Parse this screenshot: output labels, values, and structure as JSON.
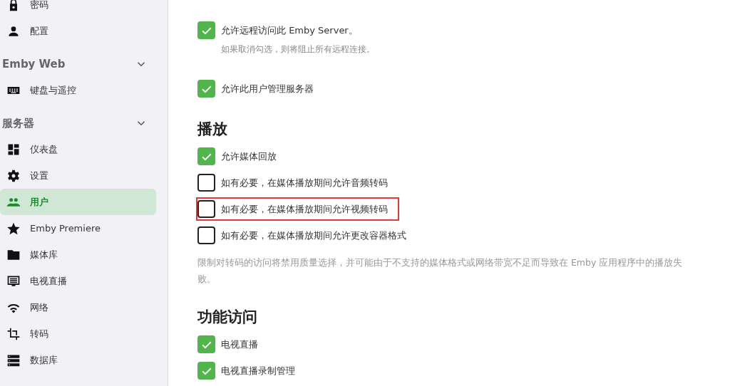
{
  "sidebar": {
    "groups": [
      {
        "items": [
          {
            "label": "密码",
            "kind": "lock",
            "selected": false
          },
          {
            "label": "配置",
            "kind": "person",
            "selected": false
          }
        ]
      },
      {
        "title": "Emby Web",
        "expanded": true,
        "items": [
          {
            "label": "键盘与遥控",
            "kind": "keyboard",
            "selected": false
          }
        ]
      },
      {
        "title": "服务器",
        "expanded": true,
        "items": [
          {
            "label": "仪表盘",
            "kind": "dashboard",
            "selected": false
          },
          {
            "label": "设置",
            "kind": "gear",
            "selected": false
          },
          {
            "label": "用户",
            "kind": "people",
            "selected": true
          },
          {
            "label": "Emby Premiere",
            "kind": "star",
            "selected": false
          },
          {
            "label": "媒体库",
            "kind": "folder",
            "selected": false
          },
          {
            "label": "电视直播",
            "kind": "tv",
            "selected": false
          },
          {
            "label": "网络",
            "kind": "wifi",
            "selected": false
          },
          {
            "label": "转码",
            "kind": "crop",
            "selected": false
          },
          {
            "label": "数据库",
            "kind": "storage",
            "selected": false
          }
        ]
      }
    ]
  },
  "sections": [
    {
      "options": [
        {
          "label": "允许远程访问此 Emby Server。",
          "checked": true,
          "highlighted": false,
          "hint": "如果取消勾选，则将阻止所有远程连接。"
        },
        {
          "label": "允许此用户管理服务器",
          "checked": true,
          "highlighted": false
        }
      ]
    },
    {
      "title": "播放",
      "options": [
        {
          "label": "允许媒体回放",
          "checked": true,
          "highlighted": false
        },
        {
          "label": "如有必要，在媒体播放期间允许音频转码",
          "checked": false,
          "highlighted": false
        },
        {
          "label": "如有必要，在媒体播放期间允许视频转码",
          "checked": false,
          "highlighted": true
        },
        {
          "label": "如有必要，在媒体播放期间允许更改容器格式",
          "checked": false,
          "highlighted": false
        }
      ],
      "note": "限制对转码的访问将禁用质量选择，并可能由于不支持的媒体格式或网络带宽不足而导致在 Emby 应用程序中的播放失败。"
    },
    {
      "title": "功能访问",
      "options": [
        {
          "label": "电视直播",
          "checked": true,
          "highlighted": false
        },
        {
          "label": "电视直播录制管理",
          "checked": true,
          "highlighted": false
        }
      ]
    }
  ]
}
